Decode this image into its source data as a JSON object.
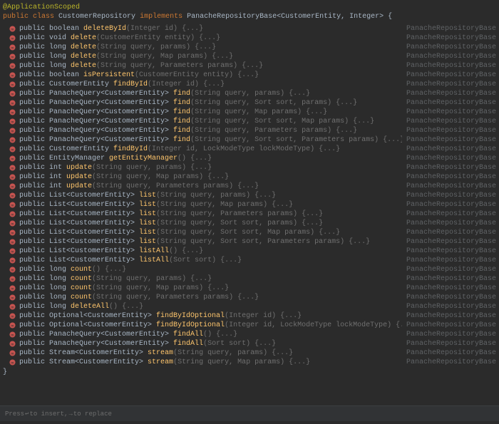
{
  "header": {
    "annotation": "@ApplicationScoped",
    "decl_keywords": "public class",
    "class_name": "CustomerRepository",
    "implements_kw": "implements",
    "iface": "PanacheRepositoryBase<CustomerEntity, Integer>",
    "open_brace": " {"
  },
  "close_brace": "}",
  "source_label": "PanacheRepositoryBase",
  "color": {
    "icon_circle": "#c75450",
    "icon_glyph": "#2b2b2b"
  },
  "methods": [
    {
      "pub": "public",
      "ret": "boolean",
      "name": "deleteById",
      "params": "(Integer id)",
      "body": " {...}"
    },
    {
      "pub": "public",
      "ret": "void",
      "name": "delete",
      "params": "(CustomerEntity entity)",
      "body": " {...}"
    },
    {
      "pub": "public",
      "ret": "long",
      "name": "delete",
      "params": "(String query,  params)",
      "body": " {...}"
    },
    {
      "pub": "public",
      "ret": "long",
      "name": "delete",
      "params": "(String query, Map params)",
      "body": " {...}"
    },
    {
      "pub": "public",
      "ret": "long",
      "name": "delete",
      "params": "(String query, Parameters params)",
      "body": " {...}"
    },
    {
      "pub": "public",
      "ret": "boolean",
      "name": "isPersistent",
      "params": "(CustomerEntity entity)",
      "body": " {...}"
    },
    {
      "pub": "public",
      "ret": "CustomerEntity",
      "name": "findById",
      "params": "(Integer id)",
      "body": " {...}"
    },
    {
      "pub": "public",
      "ret": "PanacheQuery<CustomerEntity>",
      "name": "find",
      "params": "(String query,  params)",
      "body": " {...}"
    },
    {
      "pub": "public",
      "ret": "PanacheQuery<CustomerEntity>",
      "name": "find",
      "params": "(String query, Sort sort,  params)",
      "body": " {...}"
    },
    {
      "pub": "public",
      "ret": "PanacheQuery<CustomerEntity>",
      "name": "find",
      "params": "(String query, Map params)",
      "body": " {...}"
    },
    {
      "pub": "public",
      "ret": "PanacheQuery<CustomerEntity>",
      "name": "find",
      "params": "(String query, Sort sort, Map params)",
      "body": " {...}"
    },
    {
      "pub": "public",
      "ret": "PanacheQuery<CustomerEntity>",
      "name": "find",
      "params": "(String query, Parameters params)",
      "body": " {...}"
    },
    {
      "pub": "public",
      "ret": "PanacheQuery<CustomerEntity>",
      "name": "find",
      "params": "(String query, Sort sort, Parameters params)",
      "body": " {...}"
    },
    {
      "pub": "public",
      "ret": "CustomerEntity",
      "name": "findById",
      "params": "(Integer id, LockModeType lockModeType)",
      "body": " {...}"
    },
    {
      "pub": "public",
      "ret": "EntityManager",
      "name": "getEntityManager",
      "params": "()",
      "body": " {...}"
    },
    {
      "pub": "public",
      "ret": "int",
      "name": "update",
      "params": "(String query,  params)",
      "body": " {...}"
    },
    {
      "pub": "public",
      "ret": "int",
      "name": "update",
      "params": "(String query, Map params)",
      "body": " {...}"
    },
    {
      "pub": "public",
      "ret": "int",
      "name": "update",
      "params": "(String query, Parameters params)",
      "body": " {...}"
    },
    {
      "pub": "public",
      "ret": "List<CustomerEntity>",
      "name": "list",
      "params": "(String query,  params)",
      "body": " {...}"
    },
    {
      "pub": "public",
      "ret": "List<CustomerEntity>",
      "name": "list",
      "params": "(String query, Map params)",
      "body": " {...}"
    },
    {
      "pub": "public",
      "ret": "List<CustomerEntity>",
      "name": "list",
      "params": "(String query, Parameters params)",
      "body": " {...}"
    },
    {
      "pub": "public",
      "ret": "List<CustomerEntity>",
      "name": "list",
      "params": "(String query, Sort sort,  params)",
      "body": " {...}"
    },
    {
      "pub": "public",
      "ret": "List<CustomerEntity>",
      "name": "list",
      "params": "(String query, Sort sort, Map params)",
      "body": " {...}"
    },
    {
      "pub": "public",
      "ret": "List<CustomerEntity>",
      "name": "list",
      "params": "(String query, Sort sort, Parameters params)",
      "body": " {...}"
    },
    {
      "pub": "public",
      "ret": "List<CustomerEntity>",
      "name": "listAll",
      "params": "()",
      "body": " {...}"
    },
    {
      "pub": "public",
      "ret": "List<CustomerEntity>",
      "name": "listAll",
      "params": "(Sort sort)",
      "body": " {...}"
    },
    {
      "pub": "public",
      "ret": "long",
      "name": "count",
      "params": "()",
      "body": " {...}"
    },
    {
      "pub": "public",
      "ret": "long",
      "name": "count",
      "params": "(String query,  params)",
      "body": " {...}"
    },
    {
      "pub": "public",
      "ret": "long",
      "name": "count",
      "params": "(String query, Map params)",
      "body": " {...}"
    },
    {
      "pub": "public",
      "ret": "long",
      "name": "count",
      "params": "(String query, Parameters params)",
      "body": " {...}"
    },
    {
      "pub": "public",
      "ret": "long",
      "name": "deleteAll",
      "params": "()",
      "body": " {...}"
    },
    {
      "pub": "public",
      "ret": "Optional<CustomerEntity>",
      "name": "findByIdOptional",
      "params": "(Integer id)",
      "body": " {...}"
    },
    {
      "pub": "public",
      "ret": "Optional<CustomerEntity>",
      "name": "findByIdOptional",
      "params": "(Integer id, LockModeType lockModeType)",
      "body": " {...}"
    },
    {
      "pub": "public",
      "ret": "PanacheQuery<CustomerEntity>",
      "name": "findAll",
      "params": "()",
      "body": " {...}"
    },
    {
      "pub": "public",
      "ret": "PanacheQuery<CustomerEntity>",
      "name": "findAll",
      "params": "(Sort sort)",
      "body": " {...}"
    },
    {
      "pub": "public",
      "ret": "Stream<CustomerEntity>",
      "name": "stream",
      "params": "(String query,  params)",
      "body": " {...}"
    },
    {
      "pub": "public",
      "ret": "Stream<CustomerEntity>",
      "name": "stream",
      "params": "(String query, Map params)",
      "body": " {...}"
    }
  ],
  "statusbar": {
    "prefix": "Press ",
    "key1": "↩",
    "mid1": " to insert, ",
    "key2": "→",
    "mid2": " to replace"
  }
}
